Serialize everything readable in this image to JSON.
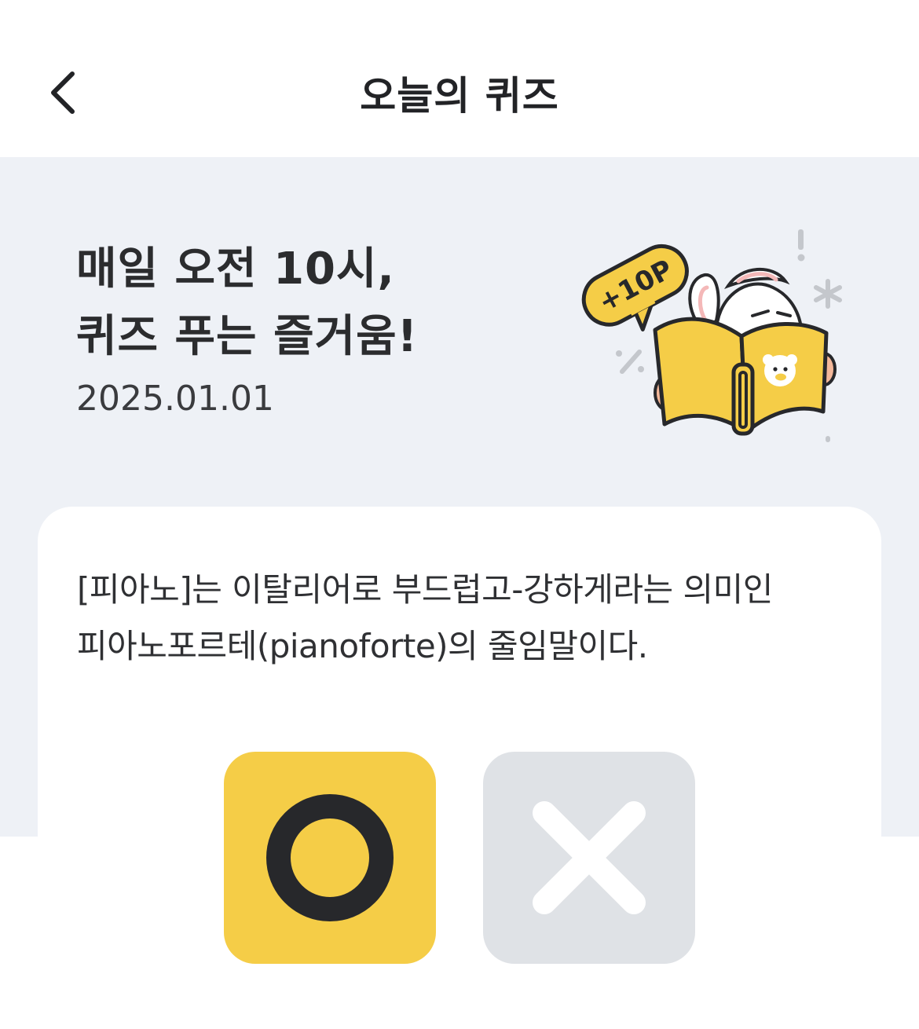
{
  "header": {
    "title": "오늘의 퀴즈",
    "back_icon": "chevron-left-icon"
  },
  "hero": {
    "heading_line1": "매일 오전 10시,",
    "heading_line2": "퀴즈 푸는 즐거움!",
    "date": "2025.01.01",
    "badge_text": "+10P"
  },
  "quiz": {
    "question_line1": "[피아노]는 이탈리어로 부드럽고-강하게라는 의미인",
    "question_line2": "피아노포르테(pianoforte)의 줄임말이다.",
    "answer_o_icon": "circle-o-icon",
    "answer_x_icon": "x-mark-icon"
  },
  "colors": {
    "accent_yellow": "#f5cd47",
    "hero_bg": "#eef1f6",
    "x_button_bg": "#dfe2e6",
    "text_dark": "#2b2c2e"
  }
}
